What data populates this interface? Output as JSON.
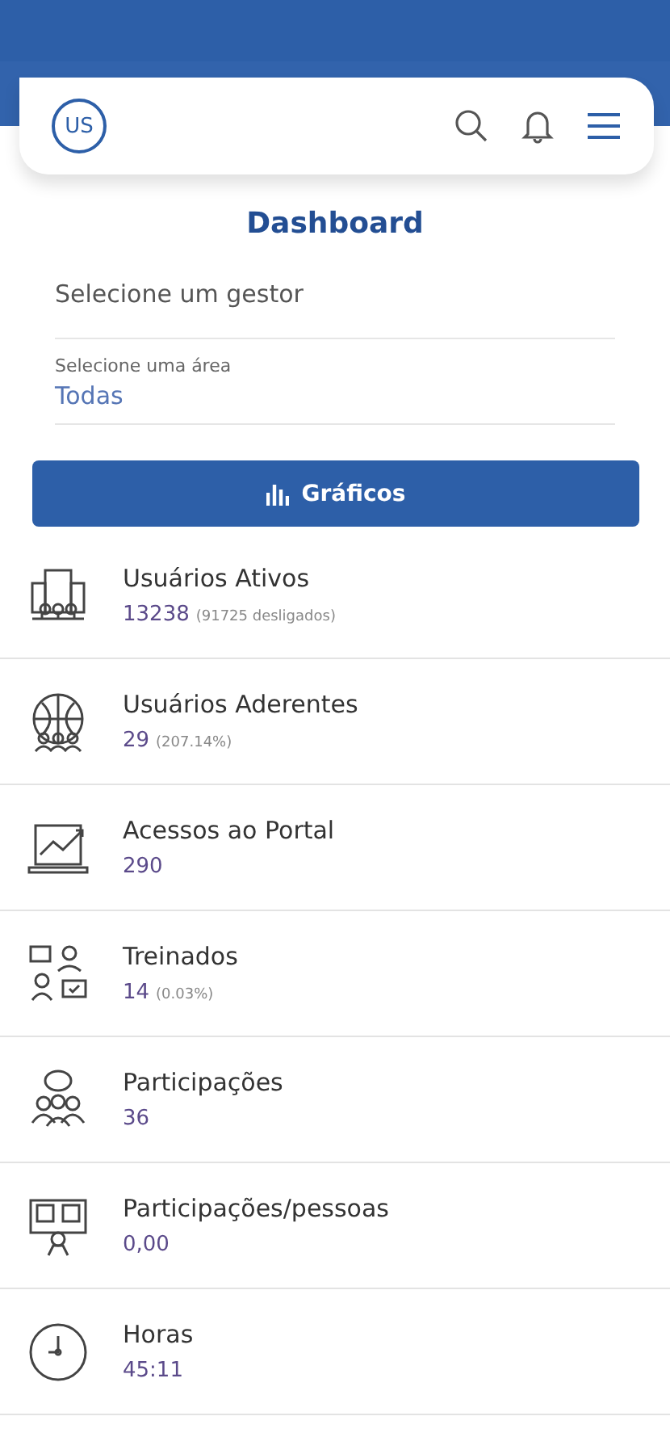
{
  "header": {
    "avatar": "US"
  },
  "title": "Dashboard",
  "filters": [
    {
      "kind": "select",
      "value": "Selecione um gestor"
    },
    {
      "kind": "labeled",
      "label": "Selecione uma área",
      "value": "Todas"
    }
  ],
  "charts_button": "Gráficos",
  "metrics": [
    {
      "name": "Usuários Ativos",
      "value": "13238",
      "note": "(91725 desligados)"
    },
    {
      "name": "Usuários Aderentes",
      "value": "29",
      "note": "(207.14%)"
    },
    {
      "name": "Acessos ao Portal",
      "value": "290"
    },
    {
      "name": "Treinados",
      "value": "14",
      "note": "(0.03%)"
    },
    {
      "name": "Participações",
      "value": "36"
    },
    {
      "name": "Participações/pessoas",
      "value": "0,00"
    },
    {
      "name": "Horas",
      "value": "45:11"
    }
  ]
}
